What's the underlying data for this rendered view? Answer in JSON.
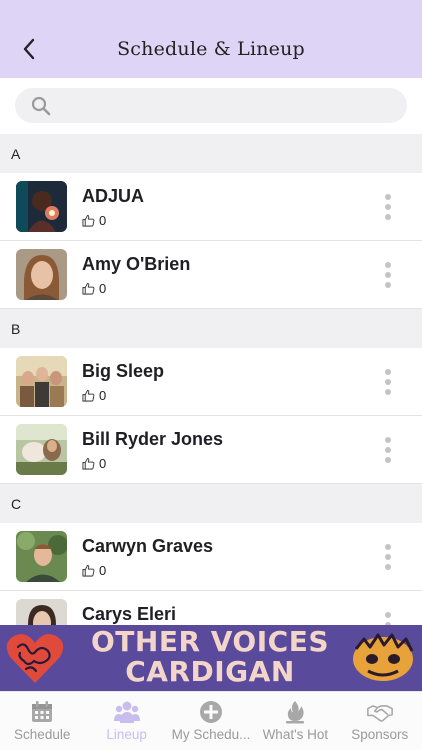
{
  "header": {
    "title": "Schedule & Lineup"
  },
  "search": {
    "placeholder": "",
    "value": ""
  },
  "sections": [
    {
      "letter": "A",
      "artists": [
        {
          "name": "ADJUA",
          "likes": "0"
        },
        {
          "name": "Amy O'Brien",
          "likes": "0"
        }
      ]
    },
    {
      "letter": "B",
      "artists": [
        {
          "name": "Big Sleep",
          "likes": "0"
        },
        {
          "name": "Bill Ryder Jones",
          "likes": "0"
        }
      ]
    },
    {
      "letter": "C",
      "artists": [
        {
          "name": "Carwyn Graves",
          "likes": "0"
        },
        {
          "name": "Carys Eleri",
          "likes": "0"
        }
      ]
    }
  ],
  "banner": {
    "line1": "OTHER VOICES",
    "line2": "CARDIGAN"
  },
  "tabs": [
    {
      "label": "Schedule",
      "icon": "calendar-icon"
    },
    {
      "label": "Lineup",
      "icon": "people-icon"
    },
    {
      "label": "My Schedu...",
      "icon": "plus-circle-icon"
    },
    {
      "label": "What's Hot",
      "icon": "flame-icon"
    },
    {
      "label": "Sponsors",
      "icon": "handshake-icon"
    }
  ],
  "colors": {
    "header_bg": "#ddd4f6",
    "active_tab": "#c9bdf0",
    "banner_bg": "#5a4a9c"
  }
}
